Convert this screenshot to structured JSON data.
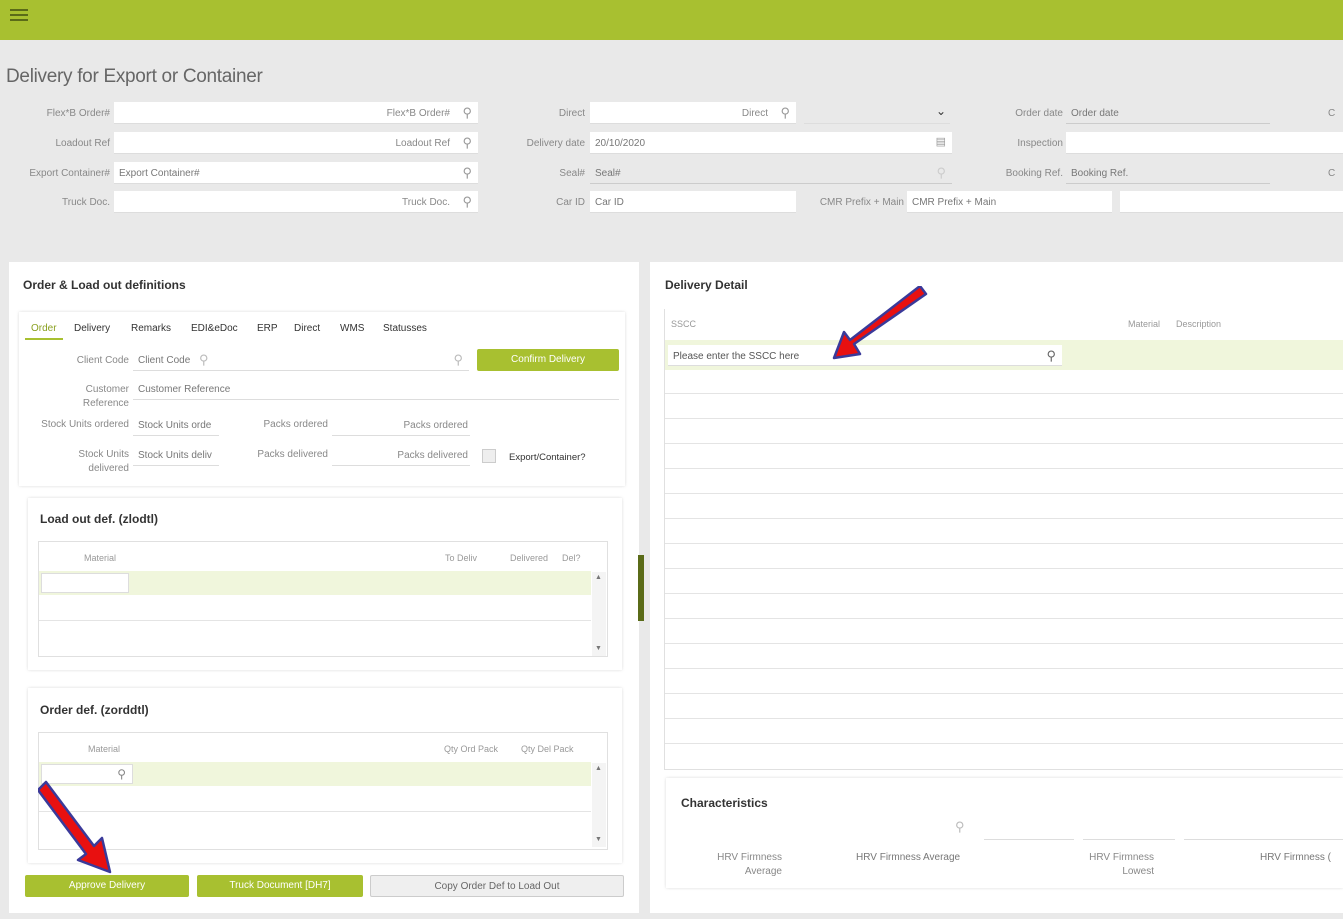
{
  "header": {
    "menu_icon": "hamburger-icon",
    "accent": "#a8c030"
  },
  "page_title": "Delivery for Export or Container",
  "filters": {
    "flexb_order": {
      "label": "Flex*B Order#",
      "placeholder": "Flex*B Order#"
    },
    "loadout_ref": {
      "label": "Loadout Ref",
      "placeholder": "Loadout Ref"
    },
    "export_container": {
      "label": "Export Container#",
      "value": "Export Container#"
    },
    "truck_doc": {
      "label": "Truck Doc.",
      "placeholder": "Truck Doc."
    },
    "direct": {
      "label": "Direct",
      "placeholder": "Direct"
    },
    "delivery_date": {
      "label": "Delivery date",
      "value": "20/10/2020"
    },
    "seal": {
      "label": "Seal#",
      "value": "Seal#"
    },
    "car_id": {
      "label": "Car ID",
      "value": "Car ID"
    },
    "cmr_prefix": {
      "label": "CMR Prefix + Main",
      "value": "CMR Prefix + Main"
    },
    "order_date": {
      "label": "Order date",
      "value": "Order date"
    },
    "inspection": {
      "label": "Inspection"
    },
    "booking_ref": {
      "label": "Booking Ref.",
      "value": "Booking Ref."
    },
    "cut_c1": "C",
    "cut_c2": "C"
  },
  "order_panel": {
    "title": "Order & Load out definitions",
    "tabs": [
      "Order",
      "Delivery",
      "Remarks",
      "EDI&eDoc",
      "ERP",
      "Direct",
      "WMS",
      "Statusses"
    ],
    "client_code": {
      "label": "Client Code",
      "value": "Client Code"
    },
    "confirm_button": "Confirm Delivery",
    "customer_reference": {
      "label_1": "Customer",
      "label_2": "Reference",
      "value": "Customer Reference"
    },
    "stock_units_ordered": {
      "label": "Stock Units ordered",
      "value": "Stock Units orde"
    },
    "packs_ordered": {
      "label": "Packs ordered",
      "value": "Packs ordered"
    },
    "stock_units_delivered": {
      "label_1": "Stock Units",
      "label_2": "delivered",
      "value": "Stock Units deliv"
    },
    "packs_delivered": {
      "label": "Packs delivered",
      "value": "Packs delivered"
    },
    "export_container_check": "Export/Container?"
  },
  "loadout_def": {
    "title": "Load out def. (zlodtl)",
    "columns": [
      "Material",
      "To Deliv",
      "Delivered",
      "Del?"
    ]
  },
  "order_def": {
    "title": "Order def. (zorddtl)",
    "columns": [
      "Material",
      "Qty Ord Pack",
      "Qty Del Pack"
    ]
  },
  "buttons": {
    "approve": "Approve Delivery",
    "truck_document": "Truck Document [DH7]",
    "copy_order_def": "Copy Order Def to Load Out"
  },
  "delivery_detail": {
    "title": "Delivery Detail",
    "columns": [
      "SSCC",
      "Material",
      "Description"
    ],
    "sscc_placeholder": "Please enter the SSCC here"
  },
  "characteristics": {
    "title": "Characteristics",
    "col1_line1": "HRV Firmness",
    "col1_line2": "Average",
    "col2": "HRV Firmness Average",
    "col3_line1": "HRV Firmness",
    "col3_line2": "Lowest",
    "col4": "HRV Firmness ("
  },
  "annotation_color": "#e81010"
}
